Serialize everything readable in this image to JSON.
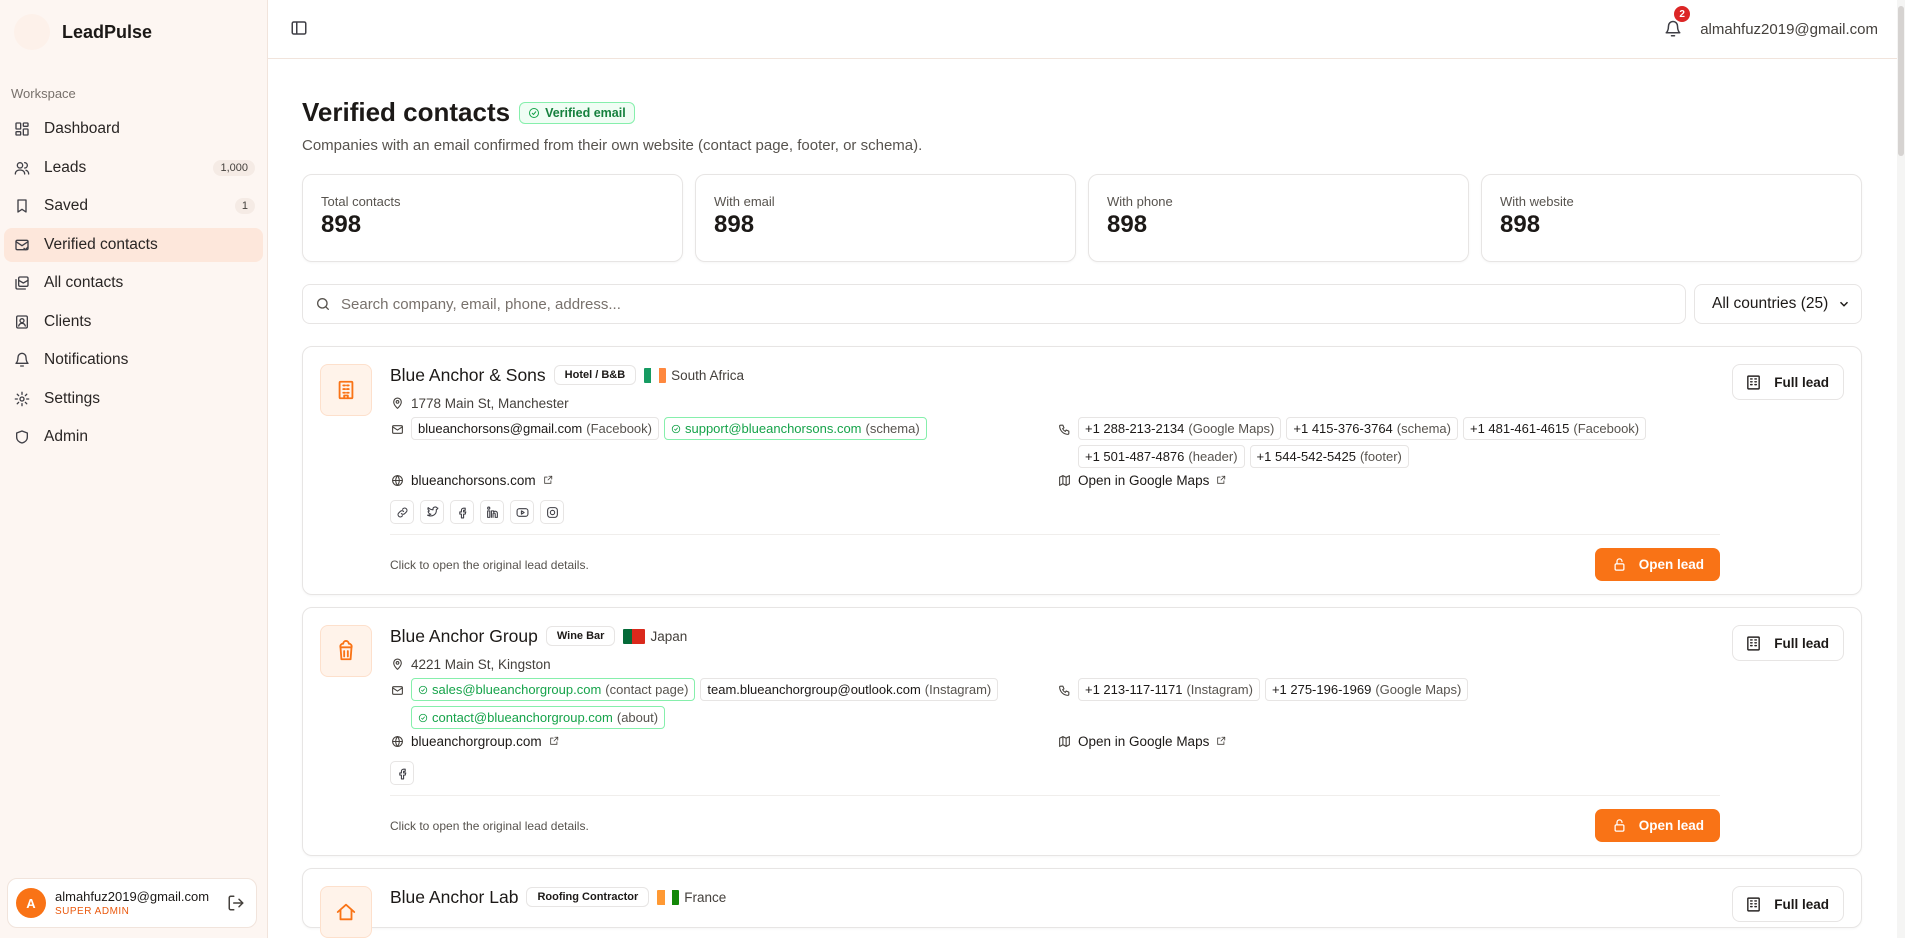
{
  "brand": {
    "name": "LeadPulse"
  },
  "sidebar": {
    "section_label": "Workspace",
    "items": [
      {
        "label": "Dashboard",
        "icon": "dashboard-icon",
        "badge": ""
      },
      {
        "label": "Leads",
        "icon": "users-icon",
        "badge": "1,000"
      },
      {
        "label": "Saved",
        "icon": "bookmark-icon",
        "badge": "1"
      },
      {
        "label": "Verified contacts",
        "icon": "mail-check-icon",
        "badge": "",
        "active": true
      },
      {
        "label": "All contacts",
        "icon": "contacts-icon",
        "badge": ""
      },
      {
        "label": "Clients",
        "icon": "client-icon",
        "badge": ""
      },
      {
        "label": "Notifications",
        "icon": "bell-icon",
        "badge": ""
      },
      {
        "label": "Settings",
        "icon": "gear-icon",
        "badge": ""
      },
      {
        "label": "Admin",
        "icon": "shield-icon",
        "badge": ""
      }
    ],
    "user": {
      "initial": "A",
      "email": "almahfuz2019@gmail.com",
      "role": "SUPER ADMIN"
    }
  },
  "topbar": {
    "notification_count": "2",
    "email": "almahfuz2019@gmail.com"
  },
  "page": {
    "title": "Verified contacts",
    "badge": "Verified email",
    "subtitle": "Companies with an email confirmed from their own website (contact page, footer, or schema)."
  },
  "stats": [
    {
      "label": "Total contacts",
      "value": "898"
    },
    {
      "label": "With email",
      "value": "898"
    },
    {
      "label": "With phone",
      "value": "898"
    },
    {
      "label": "With website",
      "value": "898"
    }
  ],
  "filters": {
    "search_placeholder": "Search company, email, phone, address...",
    "country_value": "All countries (25)"
  },
  "actions": {
    "full_lead": "Full lead",
    "open_lead": "Open lead",
    "foot_note": "Click to open the original lead details.",
    "open_maps": "Open in Google Maps"
  },
  "leads": [
    {
      "name": "Blue Anchor & Sons",
      "category": "Hotel / B&B",
      "country": "South Africa",
      "address": "1778 Main St, Manchester",
      "website": "blueanchorsons.com",
      "emails": [
        {
          "value": "blueanchorsons@gmail.com",
          "source": "(Facebook)"
        },
        {
          "value": "support@blueanchorsons.com",
          "source": "(schema)"
        }
      ],
      "phones": [
        {
          "value": "+1 288-213-2134",
          "source": "(Google Maps)"
        },
        {
          "value": "+1 415-376-3764",
          "source": "(schema)"
        },
        {
          "value": "+1 481-461-4615",
          "source": "(Facebook)"
        },
        {
          "value": "+1 501-487-4876",
          "source": "(header)"
        },
        {
          "value": "+1 544-542-5425",
          "source": "(footer)"
        }
      ]
    },
    {
      "name": "Blue Anchor Group",
      "category": "Wine Bar",
      "country": "Japan",
      "address": "4221 Main St, Kingston",
      "website": "blueanchorgroup.com",
      "emails": [
        {
          "value": "sales@blueanchorgroup.com",
          "source": "(contact page)"
        },
        {
          "value": "team.blueanchorgroup@outlook.com",
          "source": "(Instagram)"
        },
        {
          "value": "contact@blueanchorgroup.com",
          "source": "(about)"
        }
      ],
      "phones": [
        {
          "value": "+1 213-117-1171",
          "source": "(Instagram)"
        },
        {
          "value": "+1 275-196-1969",
          "source": "(Google Maps)"
        }
      ]
    },
    {
      "name": "Blue Anchor Lab",
      "category": "Roofing Contractor",
      "country": "France"
    }
  ]
}
